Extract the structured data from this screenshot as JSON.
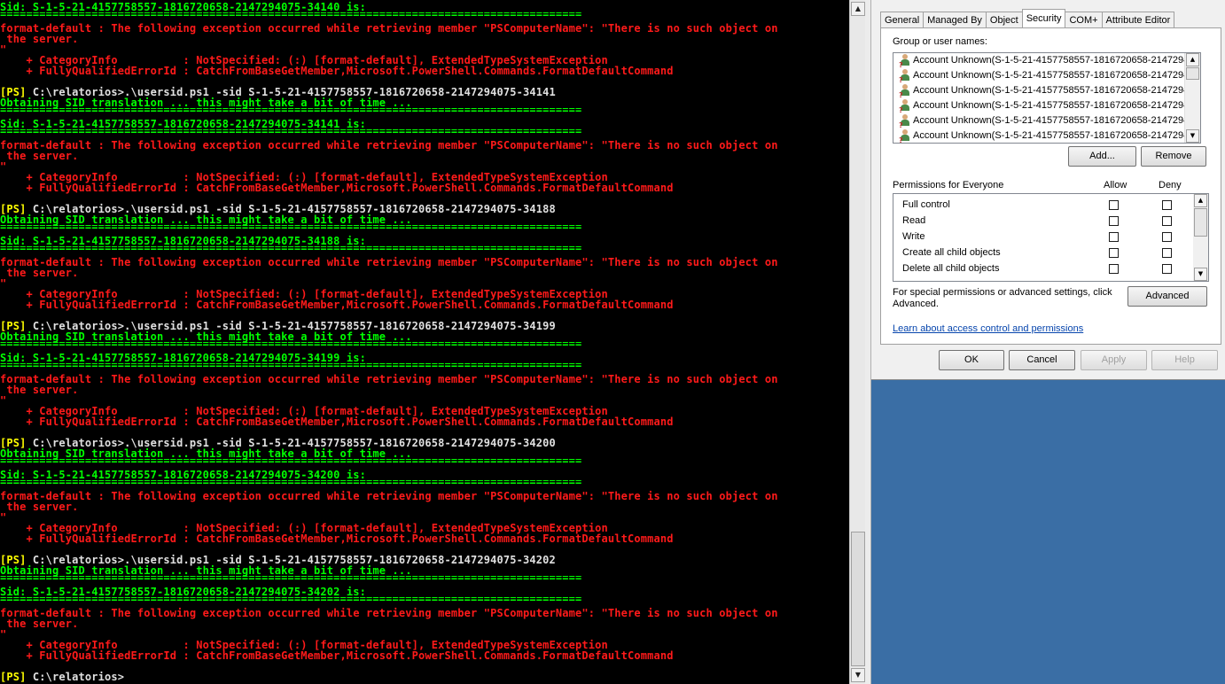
{
  "console": {
    "blocks": [
      {
        "sid_line": "Sid: S-1-5-21-4157758557-1816720658-2147294075-34140 is:",
        "error_line1": "format-default : The following exception occurred while retrieving member \"PSComputerName\": \"There is no such object on",
        "error_line2": " the server.",
        "error_line3": "\"",
        "category_line": "    + CategoryInfo          : NotSpecified: (:) [format-default], ExtendedTypeSystemException",
        "fqid_line": "    + FullyQualifiedErrorId : CatchFromBaseGetMember,Microsoft.PowerShell.Commands.FormatDefaultCommand"
      },
      {
        "prompt": "[PS]",
        "command": " C:\\relatorios>.\\usersid.ps1 -sid S-1-5-21-4157758557-1816720658-2147294075-34141",
        "obtaining": "Obtaining SID translation ... this might take a bit of time ...",
        "sid_line": "Sid: S-1-5-21-4157758557-1816720658-2147294075-34141 is:",
        "error_line1": "format-default : The following exception occurred while retrieving member \"PSComputerName\": \"There is no such object on",
        "error_line2": " the server.",
        "error_line3": "\"",
        "category_line": "    + CategoryInfo          : NotSpecified: (:) [format-default], ExtendedTypeSystemException",
        "fqid_line": "    + FullyQualifiedErrorId : CatchFromBaseGetMember,Microsoft.PowerShell.Commands.FormatDefaultCommand"
      },
      {
        "prompt": "[PS]",
        "command": " C:\\relatorios>.\\usersid.ps1 -sid S-1-5-21-4157758557-1816720658-2147294075-34188",
        "obtaining": "Obtaining SID translation ... this might take a bit of time ...",
        "sid_line": "Sid: S-1-5-21-4157758557-1816720658-2147294075-34188 is:",
        "error_line1": "format-default : The following exception occurred while retrieving member \"PSComputerName\": \"There is no such object on",
        "error_line2": " the server.",
        "error_line3": "\"",
        "category_line": "    + CategoryInfo          : NotSpecified: (:) [format-default], ExtendedTypeSystemException",
        "fqid_line": "    + FullyQualifiedErrorId : CatchFromBaseGetMember,Microsoft.PowerShell.Commands.FormatDefaultCommand"
      },
      {
        "prompt": "[PS]",
        "command": " C:\\relatorios>.\\usersid.ps1 -sid S-1-5-21-4157758557-1816720658-2147294075-34199",
        "obtaining": "Obtaining SID translation ... this might take a bit of time ...",
        "sid_line": "Sid: S-1-5-21-4157758557-1816720658-2147294075-34199 is:",
        "error_line1": "format-default : The following exception occurred while retrieving member \"PSComputerName\": \"There is no such object on",
        "error_line2": " the server.",
        "error_line3": "\"",
        "category_line": "    + CategoryInfo          : NotSpecified: (:) [format-default], ExtendedTypeSystemException",
        "fqid_line": "    + FullyQualifiedErrorId : CatchFromBaseGetMember,Microsoft.PowerShell.Commands.FormatDefaultCommand"
      },
      {
        "prompt": "[PS]",
        "command": " C:\\relatorios>.\\usersid.ps1 -sid S-1-5-21-4157758557-1816720658-2147294075-34200",
        "obtaining": "Obtaining SID translation ... this might take a bit of time ...",
        "sid_line": "Sid: S-1-5-21-4157758557-1816720658-2147294075-34200 is:",
        "error_line1": "format-default : The following exception occurred while retrieving member \"PSComputerName\": \"There is no such object on",
        "error_line2": " the server.",
        "error_line3": "\"",
        "category_line": "    + CategoryInfo          : NotSpecified: (:) [format-default], ExtendedTypeSystemException",
        "fqid_line": "    + FullyQualifiedErrorId : CatchFromBaseGetMember,Microsoft.PowerShell.Commands.FormatDefaultCommand"
      },
      {
        "prompt": "[PS]",
        "command": " C:\\relatorios>.\\usersid.ps1 -sid S-1-5-21-4157758557-1816720658-2147294075-34202",
        "obtaining": "Obtaining SID translation ... this might take a bit of time ...",
        "sid_line": "Sid: S-1-5-21-4157758557-1816720658-2147294075-34202 is:",
        "error_line1": "format-default : The following exception occurred while retrieving member \"PSComputerName\": \"There is no such object on",
        "error_line2": " the server.",
        "error_line3": "\"",
        "category_line": "    + CategoryInfo          : NotSpecified: (:) [format-default], ExtendedTypeSystemException",
        "fqid_line": "    + FullyQualifiedErrorId : CatchFromBaseGetMember,Microsoft.PowerShell.Commands.FormatDefaultCommand"
      }
    ],
    "final_prompt": "[PS]",
    "final_command": " C:\\relatorios>",
    "separator": "=========================================================================================",
    "colors": {
      "green": "#00ff00",
      "red": "#ff1a1a",
      "yellow": "#ffff00",
      "white": "#e0e0e0",
      "background": "#000000"
    }
  },
  "dialog": {
    "tabs": [
      "General",
      "Managed By",
      "Object",
      "Security",
      "COM+",
      "Attribute Editor"
    ],
    "active_tab": "Security",
    "group_label": "Group or user names:",
    "users": [
      "Account Unknown(S-1-5-21-4157758557-1816720658-2147294...",
      "Account Unknown(S-1-5-21-4157758557-1816720658-2147294...",
      "Account Unknown(S-1-5-21-4157758557-1816720658-2147294...",
      "Account Unknown(S-1-5-21-4157758557-1816720658-2147294...",
      "Account Unknown(S-1-5-21-4157758557-1816720658-2147294...",
      "Account Unknown(S-1-5-21-4157758557-1816720658-2147294..."
    ],
    "add_button": "Add...",
    "remove_button": "Remove",
    "permissions_label": "Permissions for Everyone",
    "allow_header": "Allow",
    "deny_header": "Deny",
    "permissions": [
      {
        "name": "Full control",
        "allow": false,
        "deny": false
      },
      {
        "name": "Read",
        "allow": false,
        "deny": false
      },
      {
        "name": "Write",
        "allow": false,
        "deny": false
      },
      {
        "name": "Create all child objects",
        "allow": false,
        "deny": false
      },
      {
        "name": "Delete all child objects",
        "allow": false,
        "deny": false
      }
    ],
    "special_text_1": "For special permissions or advanced settings, click",
    "special_text_2": "Advanced.",
    "advanced_button": "Advanced",
    "learn_link": "Learn about access control and permissions",
    "ok_button": "OK",
    "cancel_button": "Cancel",
    "apply_button": "Apply",
    "help_button": "Help"
  }
}
